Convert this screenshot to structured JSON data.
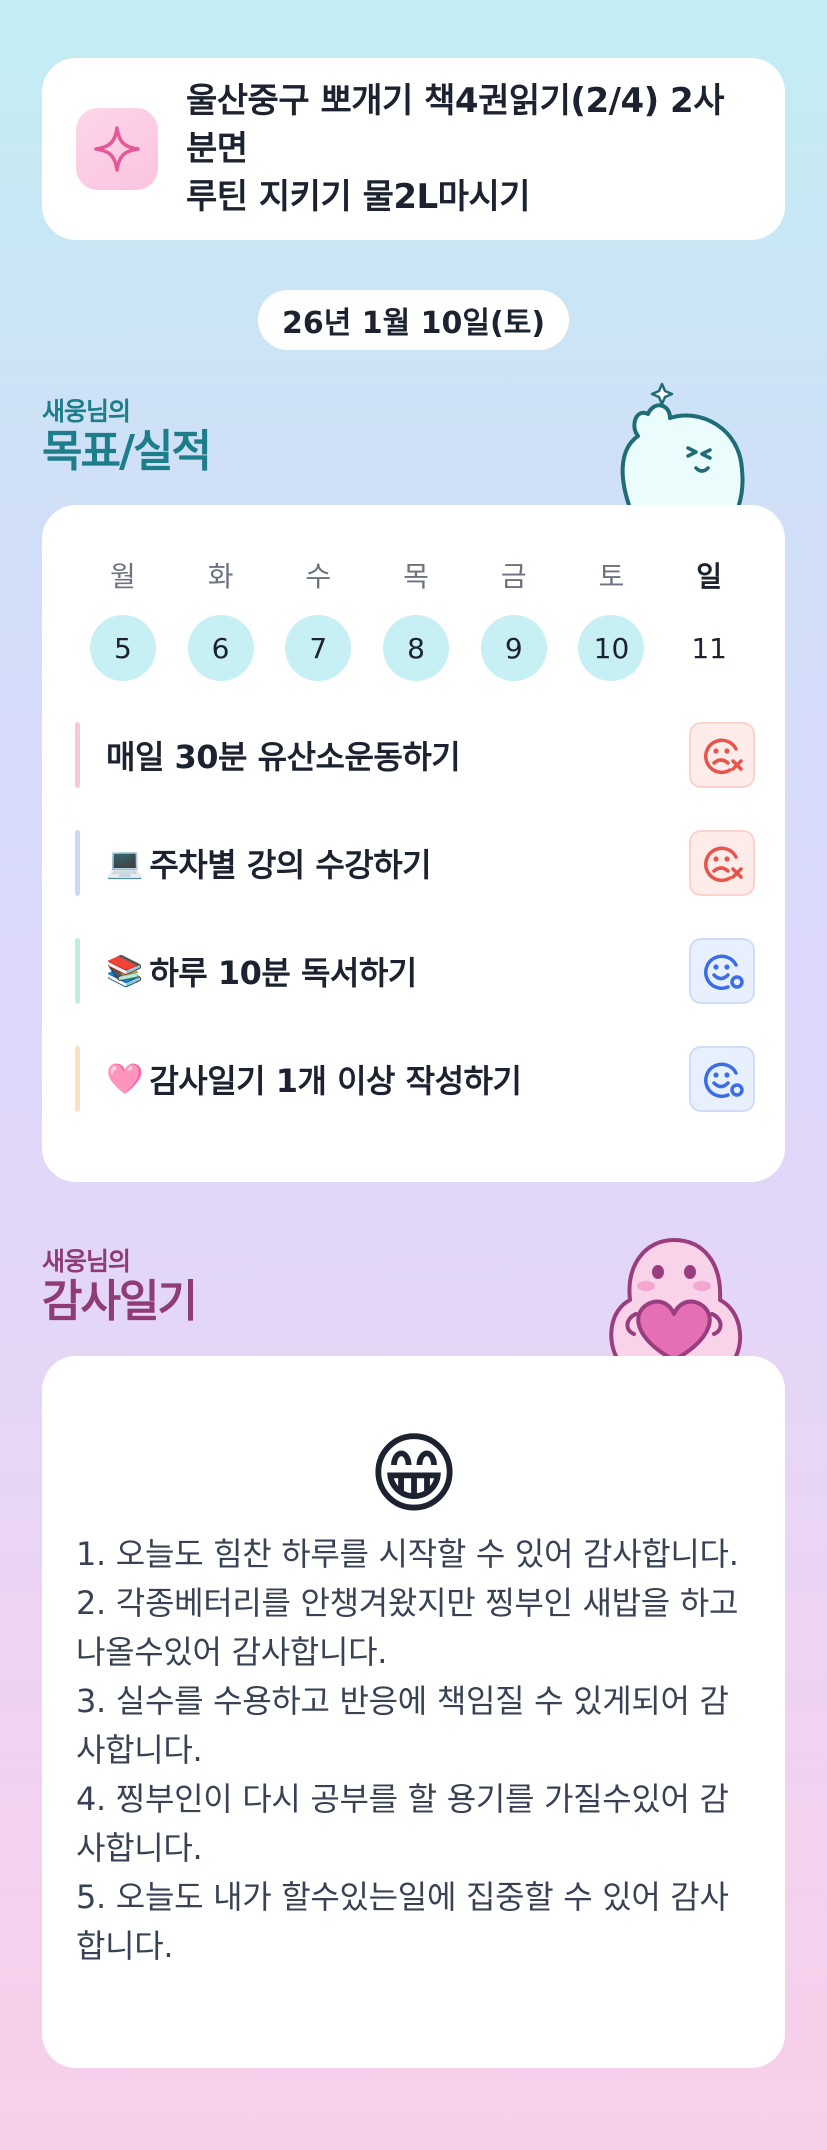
{
  "banner": {
    "icon": "sparkle-icon",
    "line1": "울산중구 뽀개기 책4권읽기(2/4) 2사분면",
    "line2": "루틴 지키기 물2L마시기"
  },
  "date_label": "26년 1월 10일(토)",
  "goals_section": {
    "owner": "새웅님의",
    "title": "목표/실적"
  },
  "week": {
    "days": [
      {
        "dow": "월",
        "date": "5",
        "done": true
      },
      {
        "dow": "화",
        "date": "6",
        "done": true
      },
      {
        "dow": "수",
        "date": "7",
        "done": true
      },
      {
        "dow": "목",
        "date": "8",
        "done": true
      },
      {
        "dow": "금",
        "date": "9",
        "done": true
      },
      {
        "dow": "토",
        "date": "10",
        "done": true
      },
      {
        "dow": "일",
        "date": "11",
        "done": false
      }
    ]
  },
  "habits": [
    {
      "emoji": "",
      "label": "매일 30분 유산소운동하기",
      "status": "fail",
      "bar_color": "#f9c9d6"
    },
    {
      "emoji": "💻",
      "label": "주차별 강의 수강하기",
      "status": "fail",
      "bar_color": "#c9d8f5"
    },
    {
      "emoji": "📚",
      "label": "하루 10분 독서하기",
      "status": "ok",
      "bar_color": "#bfeee0"
    },
    {
      "emoji": "🩷",
      "label": "감사일기 1개 이상 작성하기",
      "status": "ok",
      "bar_color": "#fde0c0"
    }
  ],
  "diary_section": {
    "owner": "새웅님의",
    "title": "감사일기"
  },
  "diary": {
    "mood_emoji": "😁",
    "entries": [
      "1. 오늘도 힘찬 하루를 시작할 수 있어 감사합니다.",
      "2. 각종베터리를 안챙겨왔지만 찡부인 새밥을 하고 나올수있어 감사합니다.",
      "3. 실수를 수용하고 반응에 책임질 수 있게되어 감사합니다.",
      "4. 찡부인이 다시 공부를 할 용기를 가질수있어 감사합니다.",
      "5. 오늘도 내가 할수있는일에 집중할 수 있어 감사합니다."
    ]
  },
  "colors": {
    "goals_title": "#1e7d8b",
    "diary_title": "#8e3b78",
    "done_day": "#c6f0f4",
    "fail_icon": "#e8544a",
    "ok_icon": "#3b6ee6"
  }
}
